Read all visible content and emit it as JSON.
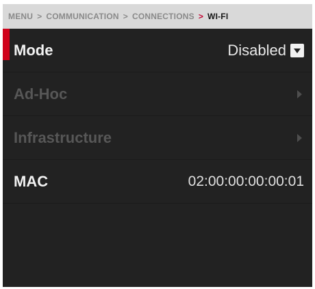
{
  "breadcrumb": {
    "items": [
      "MENU",
      "COMMUNICATION",
      "CONNECTIONS"
    ],
    "current": "WI-FI",
    "separator": ">"
  },
  "rows": {
    "mode": {
      "label": "Mode",
      "value": "Disabled",
      "icon": "dropdown-arrow-icon"
    },
    "adhoc": {
      "label": "Ad-Hoc",
      "icon": "chevron-right-icon",
      "enabled": false
    },
    "infrastructure": {
      "label": "Infrastructure",
      "icon": "chevron-right-icon",
      "enabled": false
    },
    "mac": {
      "label": "MAC",
      "value": "02:00:00:00:00:01"
    }
  },
  "colors": {
    "background": "#222222",
    "breadcrumb_bg": "#d9d9d9",
    "accent": "#d0021b",
    "text": "#f2f2f2",
    "disabled_text": "#575757"
  }
}
